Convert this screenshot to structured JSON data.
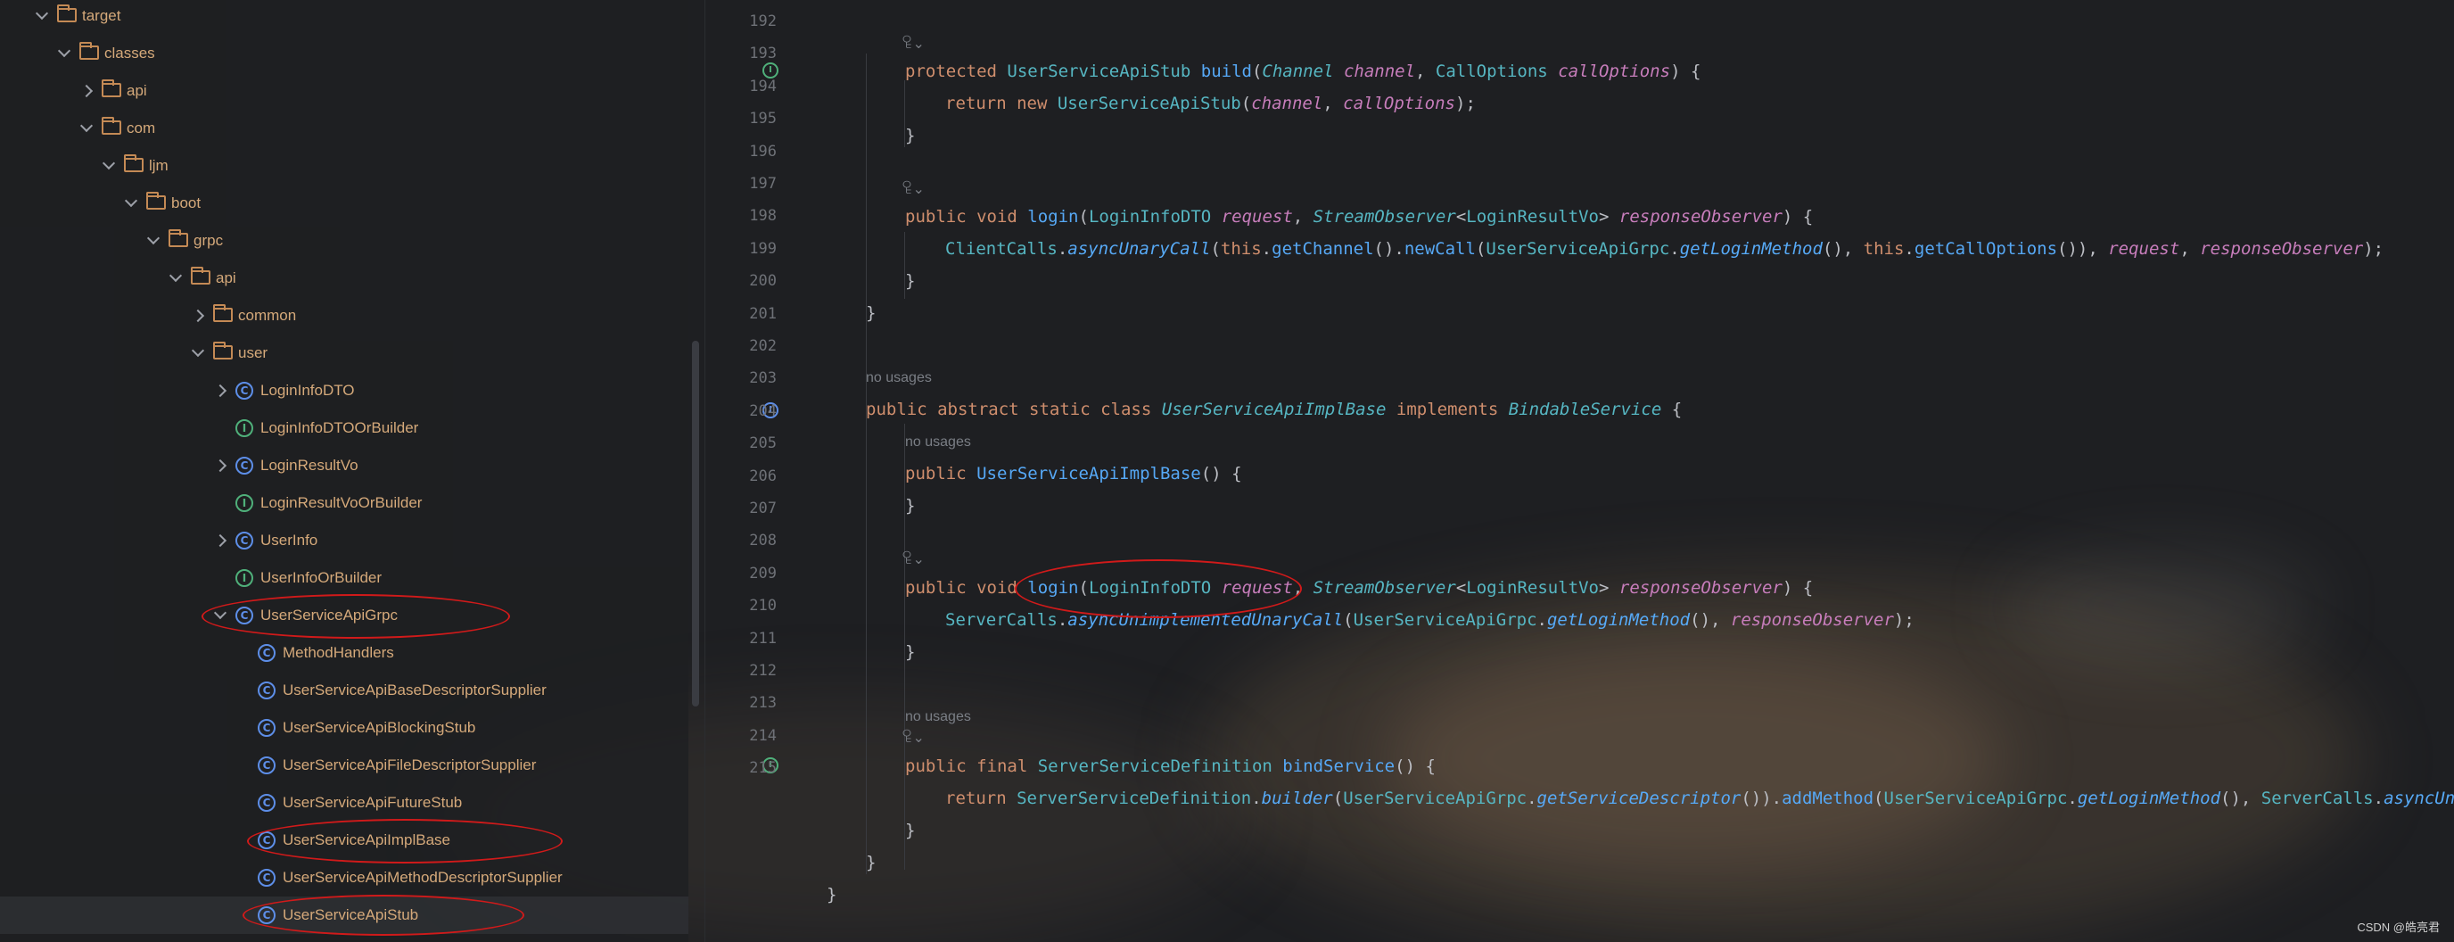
{
  "tree": {
    "items": [
      {
        "label": "target",
        "kind": "folder",
        "expanded": true
      },
      {
        "label": "classes",
        "kind": "folder",
        "expanded": true
      },
      {
        "label": "api",
        "kind": "folder",
        "expanded": false
      },
      {
        "label": "com",
        "kind": "folder",
        "expanded": true
      },
      {
        "label": "ljm",
        "kind": "folder",
        "expanded": true
      },
      {
        "label": "boot",
        "kind": "folder",
        "expanded": true
      },
      {
        "label": "grpc",
        "kind": "folder",
        "expanded": true
      },
      {
        "label": "api",
        "kind": "folder",
        "expanded": true
      },
      {
        "label": "common",
        "kind": "folder",
        "expanded": false
      },
      {
        "label": "user",
        "kind": "folder",
        "expanded": true
      },
      {
        "label": "LoginInfoDTO",
        "kind": "class",
        "expanded": false
      },
      {
        "label": "LoginInfoDTOOrBuilder",
        "kind": "interface"
      },
      {
        "label": "LoginResultVo",
        "kind": "class",
        "expanded": false
      },
      {
        "label": "LoginResultVoOrBuilder",
        "kind": "interface"
      },
      {
        "label": "UserInfo",
        "kind": "class",
        "expanded": false
      },
      {
        "label": "UserInfoOrBuilder",
        "kind": "interface"
      },
      {
        "label": "UserServiceApiGrpc",
        "kind": "class",
        "expanded": true
      },
      {
        "label": "MethodHandlers",
        "kind": "class"
      },
      {
        "label": "UserServiceApiBaseDescriptorSupplier",
        "kind": "class"
      },
      {
        "label": "UserServiceApiBlockingStub",
        "kind": "class"
      },
      {
        "label": "UserServiceApiFileDescriptorSupplier",
        "kind": "class"
      },
      {
        "label": "UserServiceApiFutureStub",
        "kind": "class"
      },
      {
        "label": "UserServiceApiImplBase",
        "kind": "class"
      },
      {
        "label": "UserServiceApiMethodDescriptorSupplier",
        "kind": "class"
      },
      {
        "label": "UserServiceApiStub",
        "kind": "class"
      }
    ],
    "class_glyph": "C",
    "interface_glyph": "I"
  },
  "editor": {
    "line_numbers": [
      "192",
      "193",
      "194",
      "195",
      "196",
      "197",
      "198",
      "199",
      "200",
      "201",
      "202",
      "203",
      "204",
      "205",
      "206",
      "207",
      "208",
      "209",
      "210",
      "211",
      "212",
      "213",
      "214",
      "215"
    ],
    "hints": {
      "no_usages": "no usages",
      "author_icon": "ꄗ⌄"
    },
    "code": {
      "l193": "protected UserServiceApiStub build(Channel channel, CallOptions callOptions) {",
      "l194": "return new UserServiceApiStub(channel, callOptions);",
      "l195": "}",
      "l197": "public void login(LoginInfoDTO request, StreamObserver<LoginResultVo> responseObserver) {",
      "l198": "ClientCalls.asyncUnaryCall(this.getChannel().newCall(UserServiceApiGrpc.getLoginMethod(), this.getCallOptions()), request, responseObserver);",
      "l199": "}",
      "l200": "}",
      "l202": "public abstract static class UserServiceApiImplBase implements BindableService {",
      "l203": "public UserServiceApiImplBase() {",
      "l204": "}",
      "l206": "public void login(LoginInfoDTO request, StreamObserver<LoginResultVo> responseObserver) {",
      "l207": "ServerCalls.asyncUnimplementedUnaryCall(UserServiceApiGrpc.getLoginMethod(), responseObserver);",
      "l208": "}",
      "l210": "public final ServerServiceDefinition bindService() {",
      "l211": "return ServerServiceDefinition.builder(UserServiceApiGrpc.getServiceDescriptor()).addMethod(UserServiceApiGrpc.getLoginMethod(), ServerCalls.asyncUnaryCal",
      "l212": "}",
      "l213": "}",
      "l214": "}"
    }
  },
  "watermark": "CSDN @皓亮君",
  "colors": {
    "annotation_red": "#d11a1a",
    "folder": "#c48a55",
    "class_icon": "#5d8ee8",
    "interface_icon": "#4fb07a"
  }
}
